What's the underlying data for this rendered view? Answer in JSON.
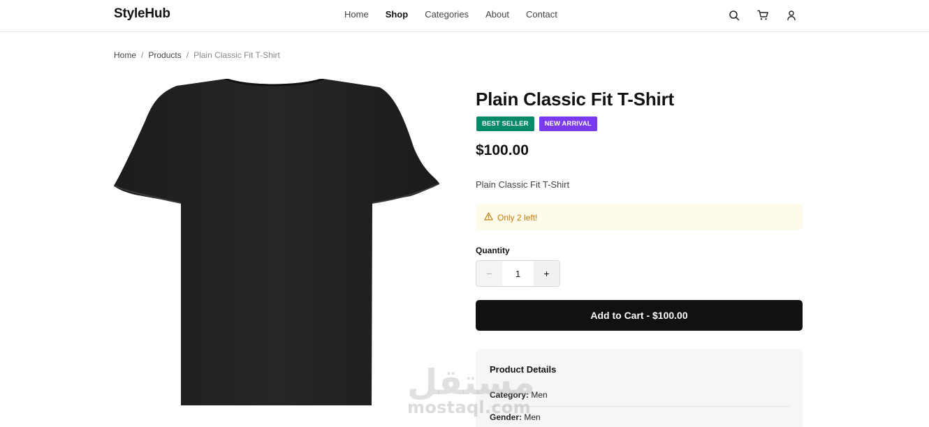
{
  "header": {
    "logo": "StyleHub",
    "nav": {
      "home": "Home",
      "shop": "Shop",
      "categories": "Categories",
      "about": "About",
      "contact": "Contact"
    },
    "icons": [
      "search-icon",
      "cart-icon",
      "user-icon"
    ]
  },
  "breadcrumb": {
    "home": "Home",
    "separator": "/",
    "products": "Products",
    "current": "Plain Classic Fit T-Shirt"
  },
  "product": {
    "title": "Plain Classic Fit T-Shirt",
    "badges": {
      "best_seller": "BEST SELLER",
      "new_arrival": "NEW ARRIVAL"
    },
    "price": "$100.00",
    "description": "Plain Classic Fit T-Shirt",
    "stock_alert": "Only 2 left!",
    "quantity_label": "Quantity",
    "quantity": "1",
    "minus_label": "−",
    "plus_label": "+",
    "add_to_cart": "Add to Cart - $100.00",
    "image_icon": "tshirt-image"
  },
  "details": {
    "title": "Product Details",
    "category_label": "Category:",
    "category_value": "Men",
    "gender_label": "Gender:",
    "gender_value": "Men"
  },
  "watermark": {
    "arabic": "مستقل",
    "latin": "mostaql.com"
  },
  "colors": {
    "best_seller_badge": "#078a67",
    "new_arrival_badge": "#7c3aed",
    "stock_alert_bg": "#fffbeb",
    "stock_alert_text": "#c47a09",
    "primary_button": "#111111"
  }
}
